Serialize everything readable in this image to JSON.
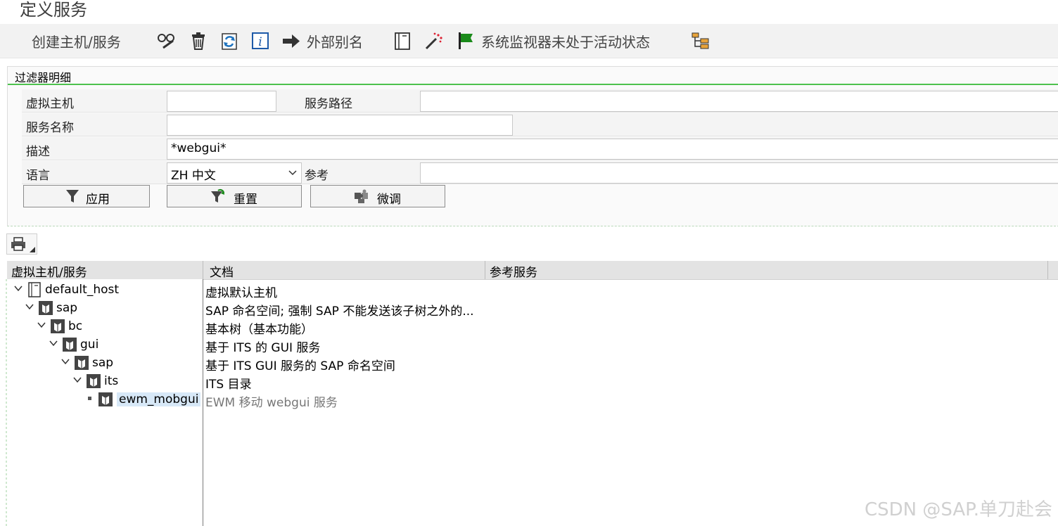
{
  "window": {
    "title": "定义服务"
  },
  "toolbar": {
    "create_label": "创建主机/服务",
    "external_alias_label": "外部别名",
    "monitor_status_label": "系统监视器未处于活动状态"
  },
  "filter": {
    "header": "过滤器明细",
    "virtual_host_label": "虚拟主机",
    "virtual_host_value": "",
    "service_path_label": "服务路径",
    "service_path_value": "",
    "service_name_label": "服务名称",
    "service_name_value": "",
    "description_label": "描述",
    "description_value": "*webgui*",
    "language_label": "语言",
    "language_value": "ZH 中文",
    "reference_label": "参考",
    "reference_value": "",
    "apply_label": "应用",
    "reset_label": "重置",
    "finetune_label": "微调"
  },
  "table": {
    "columns": [
      "虚拟主机/服务",
      "文档",
      "参考服务"
    ],
    "rows": [
      {
        "name": "default_host",
        "desc": "虚拟默认主机"
      },
      {
        "name": "sap",
        "desc": "SAP 命名空间; 强制 SAP 不能发送该子树之外的..."
      },
      {
        "name": "bc",
        "desc": "基本树（基本功能）"
      },
      {
        "name": "gui",
        "desc": "基于 ITS 的 GUI 服务"
      },
      {
        "name": "sap",
        "desc": "基于 ITS GUI 服务的 SAP 命名空间"
      },
      {
        "name": "its",
        "desc": "ITS 目录"
      },
      {
        "name": "ewm_mobgui",
        "desc": "EWM 移动 webgui 服务"
      }
    ]
  },
  "watermark": "CSDN @SAP.单刀赴会",
  "colors": {
    "green_accent": "#4dc24d",
    "selection": "#d7e8f7",
    "flag_green": "#1a8a1a"
  }
}
